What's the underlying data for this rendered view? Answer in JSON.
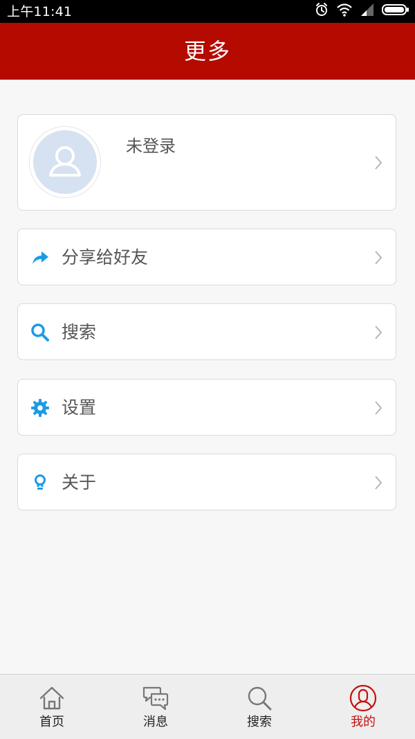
{
  "status_bar": {
    "time": "上午11:41",
    "icons": [
      "alarm-icon",
      "wifi-icon",
      "signal-icon",
      "battery-icon"
    ]
  },
  "header": {
    "title": "更多"
  },
  "profile": {
    "name": "未登录",
    "icon": "avatar-placeholder-icon"
  },
  "menu": {
    "items": [
      {
        "label": "分享给好友",
        "icon": "share-icon"
      },
      {
        "label": "搜索",
        "icon": "search-icon"
      },
      {
        "label": "设置",
        "icon": "gear-icon"
      },
      {
        "label": "关于",
        "icon": "lightbulb-icon"
      }
    ]
  },
  "tabbar": {
    "items": [
      {
        "label": "首页",
        "icon": "home-icon"
      },
      {
        "label": "消息",
        "icon": "message-icon"
      },
      {
        "label": "搜索",
        "icon": "search-icon"
      },
      {
        "label": "我的",
        "icon": "profile-icon",
        "active": true
      }
    ]
  },
  "colors": {
    "header_bg": "#b40a00",
    "accent_blue": "#1a9be6",
    "active_tab": "#c40f0f"
  }
}
